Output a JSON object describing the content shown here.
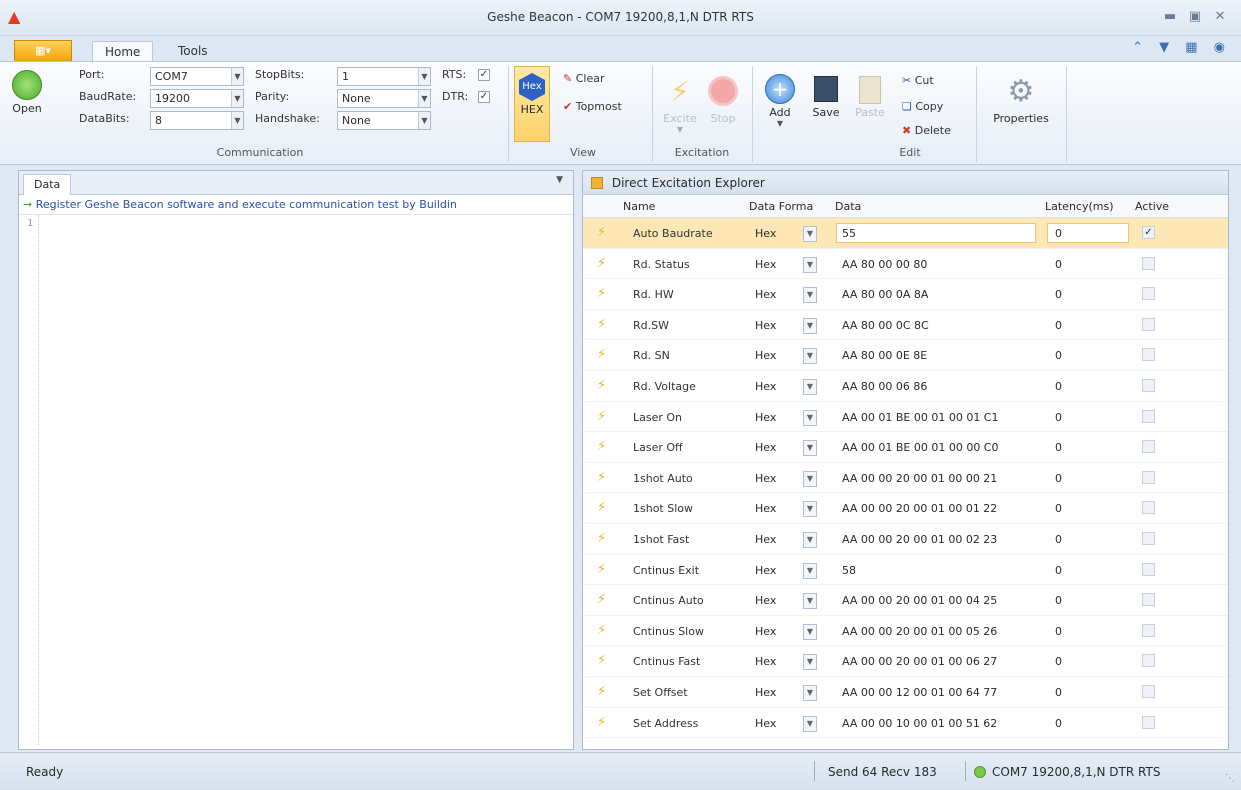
{
  "window": {
    "title": "Geshe Beacon - COM7  19200,8,1,N  DTR  RTS",
    "minimize_icon": "minimize-icon",
    "restore_icon": "restore-icon",
    "close_icon": "close-icon"
  },
  "tabs": {
    "home": "Home",
    "tools": "Tools"
  },
  "ribbon": {
    "communication": {
      "open_label": "Open",
      "port_label": "Port:",
      "port_value": "COM7",
      "baud_label": "BaudRate:",
      "baud_value": "19200",
      "databits_label": "DataBits:",
      "databits_value": "8",
      "stopbits_label": "StopBits:",
      "stopbits_value": "1",
      "parity_label": "Parity:",
      "parity_value": "None",
      "handshake_label": "Handshake:",
      "handshake_value": "None",
      "rts_label": "RTS:",
      "dtr_label": "DTR:",
      "group_label": "Communication"
    },
    "view": {
      "hex_icon_text": "Hex",
      "hex_label": "HEX",
      "clear_label": "Clear",
      "topmost_label": "Topmost",
      "group_label": "View"
    },
    "excitation": {
      "excite_label": "Excite",
      "stop_label": "Stop",
      "group_label": "Excitation"
    },
    "edit": {
      "add_label": "Add",
      "save_label": "Save",
      "paste_label": "Paste",
      "cut_label": "Cut",
      "copy_label": "Copy",
      "delete_label": "Delete",
      "group_label": "Edit"
    },
    "properties_label": "Properties"
  },
  "left_panel": {
    "tab_label": "Data",
    "register_text": "Register Geshe Beacon software and execute communication test by Buildin",
    "line_number": "1"
  },
  "explorer": {
    "title": "Direct Excitation Explorer",
    "columns": {
      "name": "Name",
      "format": "Data Forma",
      "data": "Data",
      "latency": "Latency(ms)",
      "active": "Active"
    },
    "rows": [
      {
        "name": "Auto Baudrate",
        "format": "Hex",
        "data": "55",
        "latency": "0",
        "active": true
      },
      {
        "name": "Rd. Status",
        "format": "Hex",
        "data": "AA 80 00 00 80",
        "latency": "0",
        "active": false
      },
      {
        "name": "Rd. HW",
        "format": "Hex",
        "data": "AA 80 00 0A 8A",
        "latency": "0",
        "active": false
      },
      {
        "name": "Rd.SW",
        "format": "Hex",
        "data": "AA 80 00 0C 8C",
        "latency": "0",
        "active": false
      },
      {
        "name": "Rd. SN",
        "format": "Hex",
        "data": "AA 80 00 0E 8E",
        "latency": "0",
        "active": false
      },
      {
        "name": "Rd. Voltage",
        "format": "Hex",
        "data": "AA 80 00 06 86",
        "latency": "0",
        "active": false
      },
      {
        "name": "Laser On",
        "format": "Hex",
        "data": "AA 00 01 BE 00 01 00 01 C1",
        "latency": "0",
        "active": false
      },
      {
        "name": "Laser Off",
        "format": "Hex",
        "data": "AA 00 01 BE 00 01 00 00 C0",
        "latency": "0",
        "active": false
      },
      {
        "name": "1shot Auto",
        "format": "Hex",
        "data": "AA 00 00 20 00 01 00 00 21",
        "latency": "0",
        "active": false
      },
      {
        "name": "1shot Slow",
        "format": "Hex",
        "data": "AA 00 00 20 00 01 00 01 22",
        "latency": "0",
        "active": false
      },
      {
        "name": "1shot Fast",
        "format": "Hex",
        "data": "AA 00 00 20 00 01 00 02 23",
        "latency": "0",
        "active": false
      },
      {
        "name": "Cntinus Exit",
        "format": "Hex",
        "data": "58",
        "latency": "0",
        "active": false
      },
      {
        "name": "Cntinus Auto",
        "format": "Hex",
        "data": "AA 00 00 20 00 01 00 04 25",
        "latency": "0",
        "active": false
      },
      {
        "name": "Cntinus Slow",
        "format": "Hex",
        "data": "AA 00 00 20 00 01 00 05 26",
        "latency": "0",
        "active": false
      },
      {
        "name": "Cntinus Fast",
        "format": "Hex",
        "data": "AA 00 00 20 00 01 00 06 27",
        "latency": "0",
        "active": false
      },
      {
        "name": "Set Offset",
        "format": "Hex",
        "data": "AA 00 00 12 00 01 00 64 77",
        "latency": "0",
        "active": false
      },
      {
        "name": "Set Address",
        "format": "Hex",
        "data": "AA 00 00 10 00 01 00 51 62",
        "latency": "0",
        "active": false
      }
    ]
  },
  "statusbar": {
    "ready": "Ready",
    "traffic": "Send 64  Recv 183",
    "port": "COM7  19200,8,1,N  DTR  RTS"
  }
}
